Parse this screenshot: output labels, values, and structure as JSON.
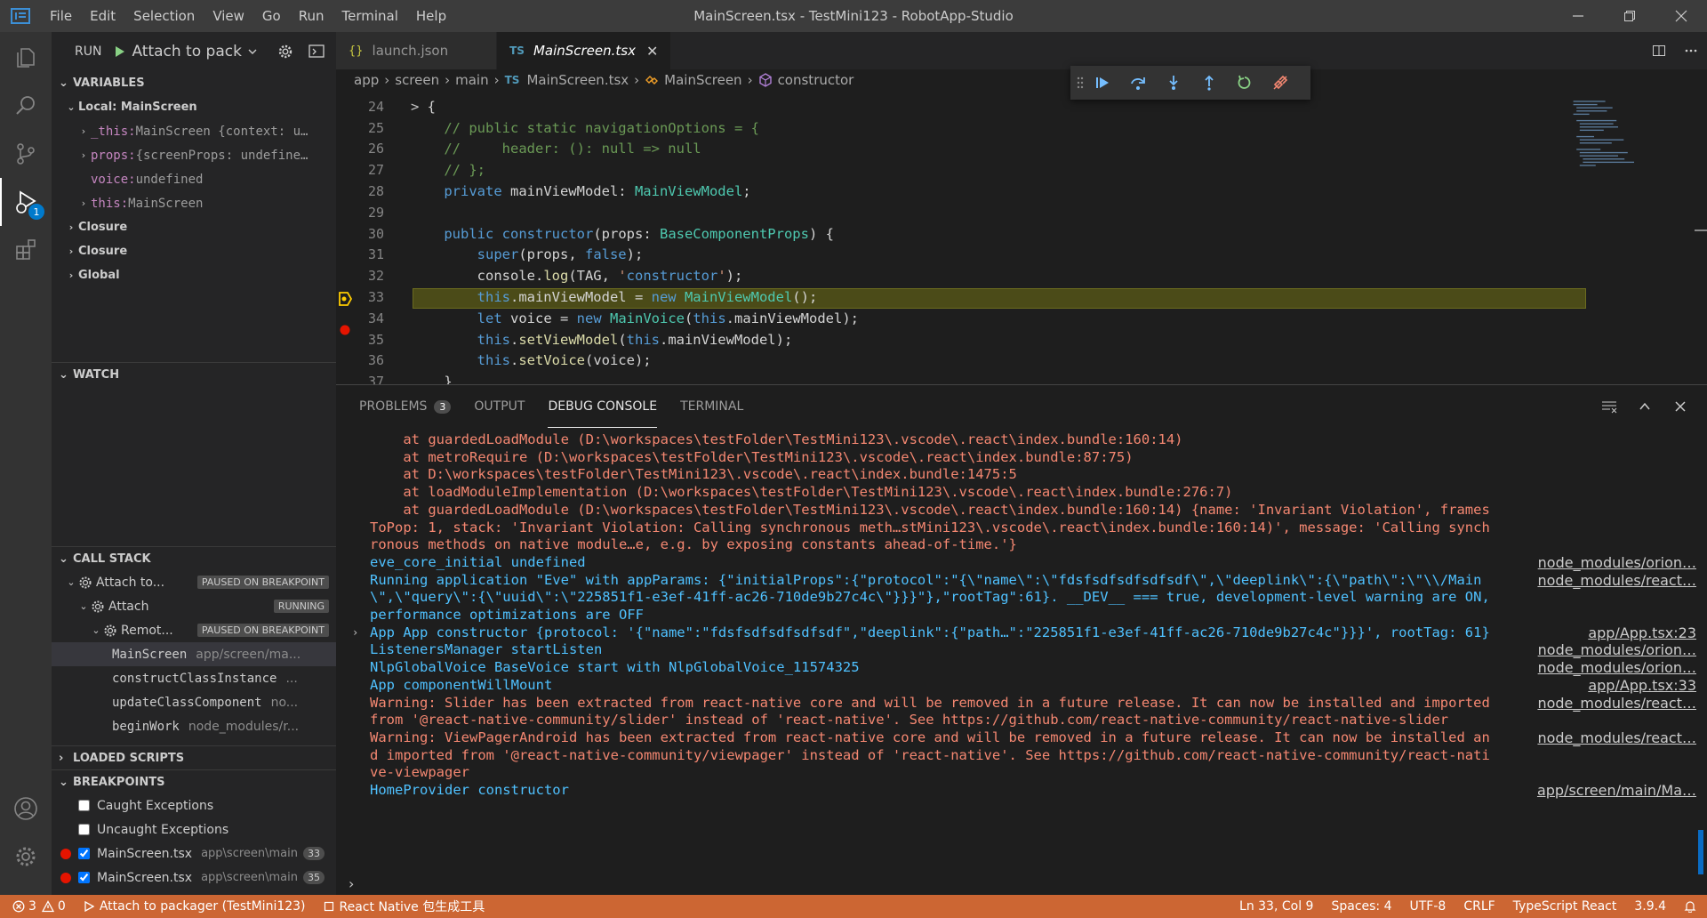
{
  "titlebar": {
    "menu": [
      "File",
      "Edit",
      "Selection",
      "View",
      "Go",
      "Run",
      "Terminal",
      "Help"
    ],
    "title": "MainScreen.tsx - TestMini123 - RobotApp-Studio"
  },
  "activitybar": {
    "debug_badge": "1"
  },
  "sidebar": {
    "run_label": "RUN",
    "config_name": "Attach to pack",
    "variables": {
      "header": "VARIABLES",
      "scope_local": "Local: MainScreen",
      "vars": [
        {
          "name": "_this:",
          "value": " MainScreen {context: u…",
          "expandable": true
        },
        {
          "name": "props:",
          "value": " {screenProps: undefine…",
          "expandable": true
        },
        {
          "name": "voice:",
          "value": " undefined",
          "expandable": false
        },
        {
          "name": "this:",
          "value": " MainScreen",
          "expandable": true
        }
      ],
      "scopes": [
        "Closure",
        "Closure",
        "Global"
      ]
    },
    "watch": {
      "header": "WATCH"
    },
    "callstack": {
      "header": "CALL STACK",
      "sessions": [
        {
          "name": "Attach to...",
          "state": "PAUSED ON BREAKPOINT"
        },
        {
          "name": "Attach",
          "state": "RUNNING"
        },
        {
          "name": "Remot...",
          "state": "PAUSED ON BREAKPOINT"
        }
      ],
      "frames": [
        {
          "fn": "MainScreen",
          "path": "app/screen/ma..."
        },
        {
          "fn": "constructClassInstance",
          "path": "..."
        },
        {
          "fn": "updateClassComponent",
          "path": "no..."
        },
        {
          "fn": "beginWork",
          "path": "node_modules/r..."
        }
      ]
    },
    "loaded_scripts": {
      "header": "LOADED SCRIPTS"
    },
    "breakpoints": {
      "header": "BREAKPOINTS",
      "items": [
        {
          "label": "Caught Exceptions",
          "checked": false,
          "dot": false
        },
        {
          "label": "Uncaught Exceptions",
          "checked": false,
          "dot": false
        },
        {
          "label": "MainScreen.tsx",
          "path": "app\\screen\\main",
          "line": "33",
          "checked": true,
          "dot": true
        },
        {
          "label": "MainScreen.tsx",
          "path": "app\\screen\\main",
          "line": "35",
          "checked": true,
          "dot": true
        }
      ]
    }
  },
  "editor": {
    "tabs": [
      {
        "label": "launch.json",
        "icon": "json-icon",
        "active": false
      },
      {
        "label": "MainScreen.tsx",
        "icon": "ts-icon",
        "active": true
      }
    ],
    "breadcrumb": [
      "app",
      "screen",
      "main",
      "MainScreen.tsx",
      "MainScreen",
      "constructor"
    ],
    "breadcrumb_ts": "TS",
    "lines": [
      {
        "n": "24",
        "html": "<span class=\"c-fold\">&gt;</span> {"
      },
      {
        "n": "25",
        "text": "    // public static navigationOptions = {"
      },
      {
        "n": "26",
        "text": "    //     header: (): null => null"
      },
      {
        "n": "27",
        "text": "    // };"
      },
      {
        "n": "28",
        "text": "    private mainViewModel: MainViewModel;"
      },
      {
        "n": "29",
        "text": ""
      },
      {
        "n": "30",
        "text": "    public constructor(props: BaseComponentProps) {"
      },
      {
        "n": "31",
        "text": "        super(props, false);"
      },
      {
        "n": "32",
        "text": "        console.log(TAG, 'constructor');"
      },
      {
        "n": "33",
        "text": "        this.mainViewModel = new MainViewModel();"
      },
      {
        "n": "34",
        "text": "        let voice = new MainVoice(this.mainViewModel);"
      },
      {
        "n": "35",
        "text": "        this.setViewModel(this.mainViewModel);"
      },
      {
        "n": "36",
        "text": "        this.setVoice(voice);"
      },
      {
        "n": "37",
        "text": "    }"
      }
    ]
  },
  "panel": {
    "tabs": [
      {
        "label": "PROBLEMS",
        "badge": "3"
      },
      {
        "label": "OUTPUT"
      },
      {
        "label": "DEBUG CONSOLE",
        "active": true
      },
      {
        "label": "TERMINAL"
      }
    ],
    "console": [
      {
        "kind": "err",
        "text": "    at guardedLoadModule (D:\\workspaces\\testFolder\\TestMini123\\.vscode\\.react\\index.bundle:160:14)",
        "src": ""
      },
      {
        "kind": "err",
        "text": "    at metroRequire (D:\\workspaces\\testFolder\\TestMini123\\.vscode\\.react\\index.bundle:87:75)",
        "src": ""
      },
      {
        "kind": "err",
        "text": "    at D:\\workspaces\\testFolder\\TestMini123\\.vscode\\.react\\index.bundle:1475:5",
        "src": ""
      },
      {
        "kind": "err",
        "text": "    at loadModuleImplementation (D:\\workspaces\\testFolder\\TestMini123\\.vscode\\.react\\index.bundle:276:7)",
        "src": ""
      },
      {
        "kind": "err",
        "text": "    at guardedLoadModule (D:\\workspaces\\testFolder\\TestMini123\\.vscode\\.react\\index.bundle:160:14) {name: 'Invariant Violation', frames",
        "src": ""
      },
      {
        "kind": "err",
        "text": "ToPop: 1, stack: 'Invariant Violation: Calling synchronous meth…stMini123\\.vscode\\.react\\index.bundle:160:14)', message: 'Calling synch",
        "src": ""
      },
      {
        "kind": "err",
        "text": "ronous methods on native module…e, e.g. by exposing constants ahead-of-time.'}",
        "src": ""
      },
      {
        "kind": "info",
        "text": "eve_core_initial undefined",
        "src": "node_modules/orion…"
      },
      {
        "kind": "info",
        "text": "Running application \"Eve\" with appParams: {\"initialProps\":{\"protocol\":\"{\\\"name\\\":\\\"fdsfsdfsdfsdfsdf\\\",\\\"deeplink\\\":{\\\"path\\\":\\\"\\\\/Main",
        "src": "node_modules/react…"
      },
      {
        "kind": "info",
        "text": "\\\",\\\"query\\\":{\\\"uuid\\\":\\\"225851f1-e3ef-41ff-ac26-710de9b27c4c\\\"}}}\"},\"rootTag\":61}. __DEV__ === true, development-level warning are ON,",
        "src": ""
      },
      {
        "kind": "info",
        "text": "performance optimizations are OFF",
        "src": ""
      },
      {
        "kind": "info",
        "text": "App App constructor {protocol: '{\"name\":\"fdsfsdfsdfsdfsdf\",\"deeplink\":{\"path…\":\"225851f1-e3ef-41ff-ac26-710de9b27c4c\"}}}', rootTag: 61}",
        "src": "app/App.tsx:23",
        "expand": true
      },
      {
        "kind": "info",
        "text": "ListenersManager startListen",
        "src": "node_modules/orion…"
      },
      {
        "kind": "info",
        "text": "NlpGlobalVoice BaseVoice start with NlpGlobalVoice_11574325",
        "src": "node_modules/orion…"
      },
      {
        "kind": "info",
        "text": "App componentWillMount",
        "src": "app/App.tsx:33"
      },
      {
        "kind": "warn",
        "text": "Warning: Slider has been extracted from react-native core and will be removed in a future release. It can now be installed and imported",
        "src": "node_modules/react…"
      },
      {
        "kind": "warn",
        "text": "from '@react-native-community/slider' instead of 'react-native'. See https://github.com/react-native-community/react-native-slider",
        "src": ""
      },
      {
        "kind": "warn",
        "text": "Warning: ViewPagerAndroid has been extracted from react-native core and will be removed in a future release. It can now be installed an",
        "src": "node_modules/react…"
      },
      {
        "kind": "warn",
        "text": "d imported from '@react-native-community/viewpager' instead of 'react-native'. See https://github.com/react-native-community/react-nati",
        "src": ""
      },
      {
        "kind": "warn",
        "text": "ve-viewpager",
        "src": ""
      },
      {
        "kind": "info",
        "text": "HomeProvider constructor",
        "src": "app/screen/main/Ma…"
      }
    ]
  },
  "statusbar": {
    "errors": "3",
    "warnings": "0",
    "debug_target": "Attach to packager (TestMini123)",
    "rn_tool": "React Native 包生成工具",
    "position": "Ln 33, Col 9",
    "spaces": "Spaces: 4",
    "encoding": "UTF-8",
    "eol": "CRLF",
    "language": "TypeScript React",
    "ts_version": "3.9.4"
  },
  "colors": {
    "statusbar": "#cc6633",
    "highlight": "#4b4b18",
    "breakpoint": "#e51400",
    "accent": "#007acc"
  }
}
